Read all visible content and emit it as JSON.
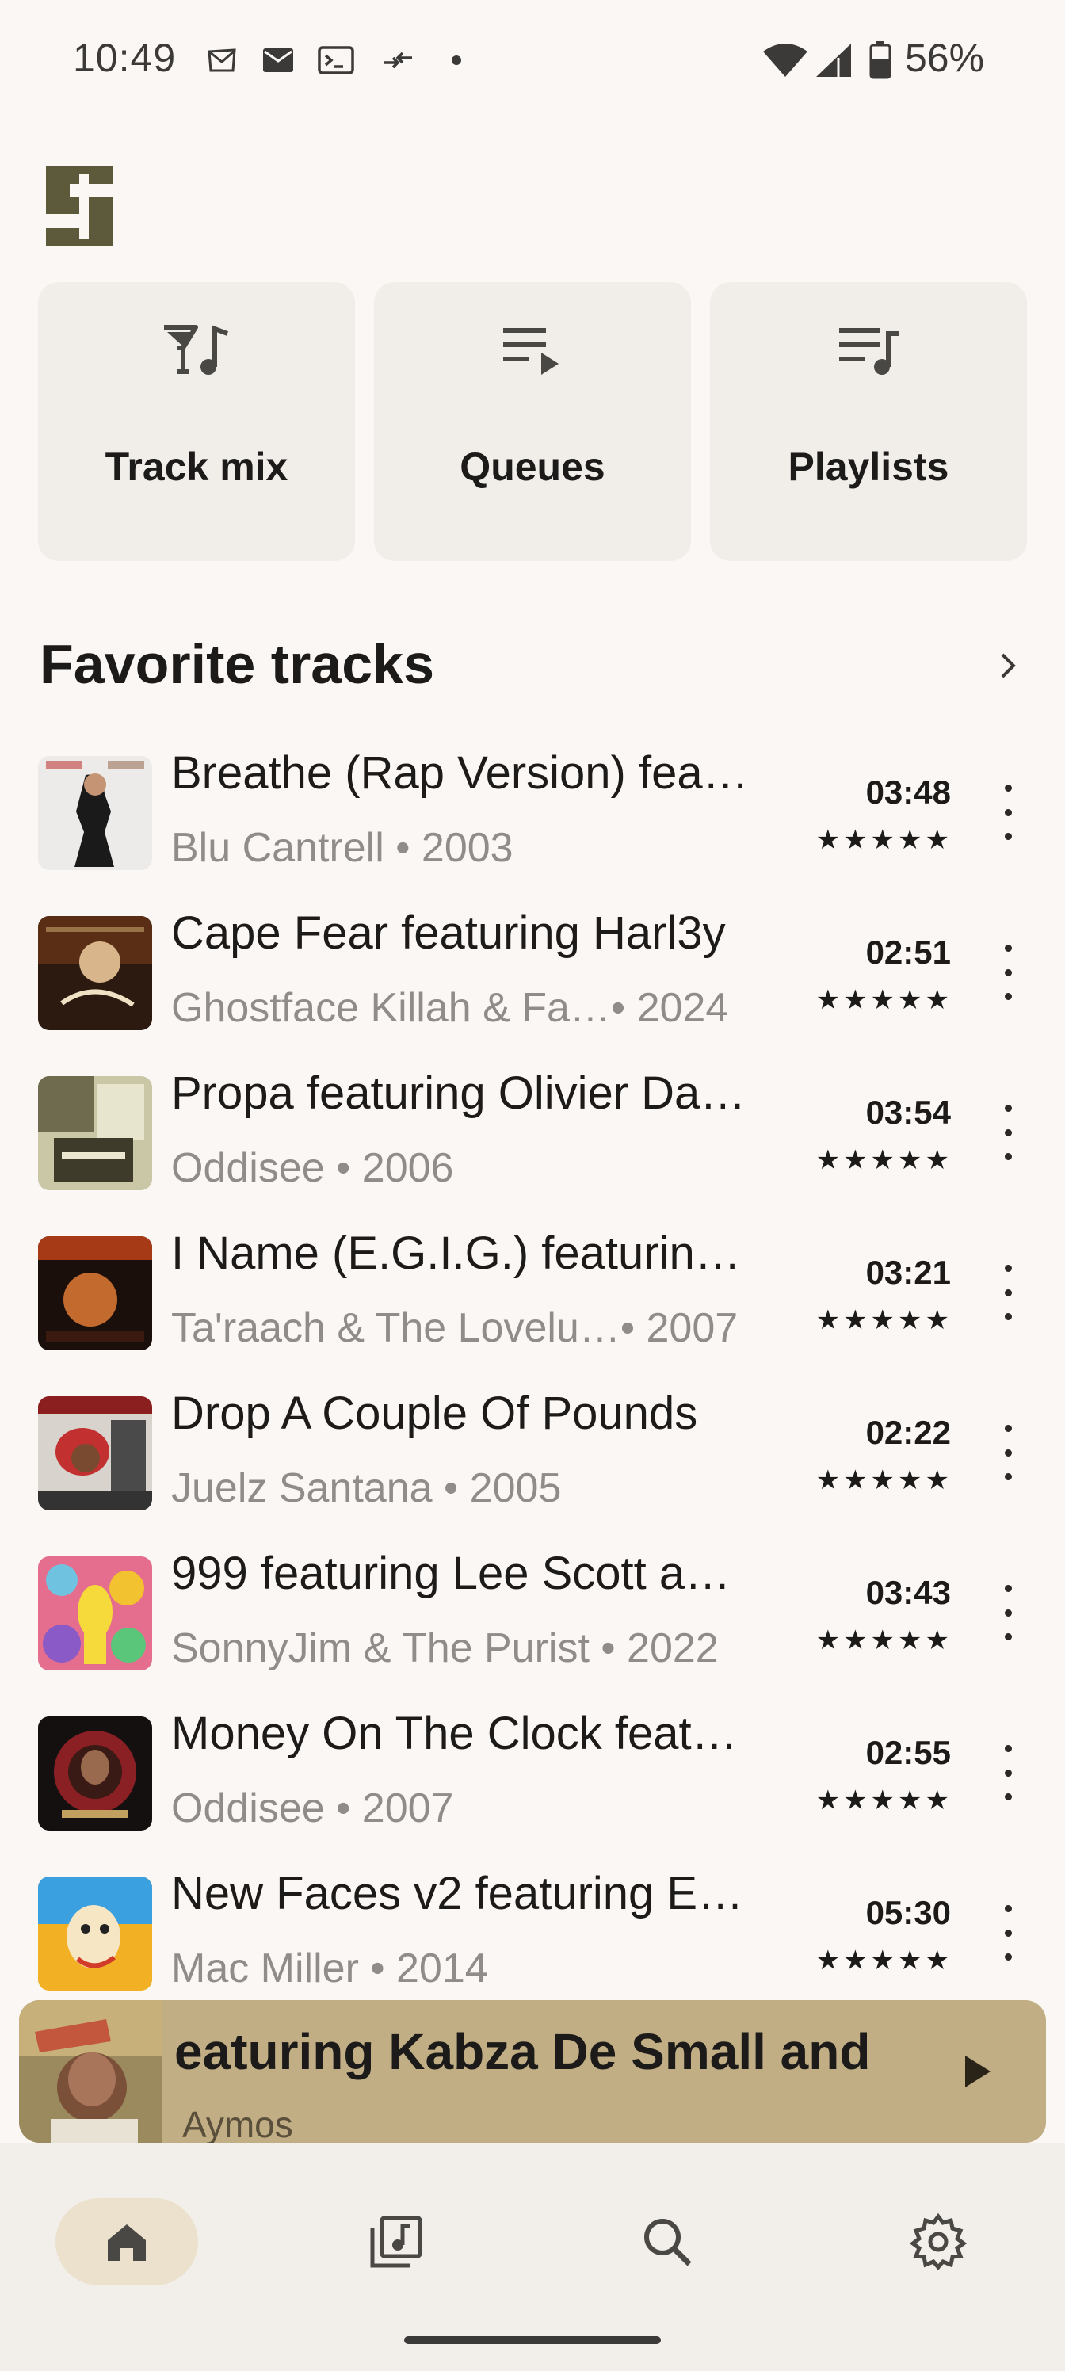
{
  "status_bar": {
    "time": "10:49",
    "battery": "56%",
    "left_icons": [
      "mail-outline-icon",
      "mail-filled-icon",
      "terminal-icon",
      "data-transfer-icon",
      "dot-icon"
    ],
    "right_icons": [
      "wifi-icon",
      "cellular-signal-icon",
      "battery-icon"
    ]
  },
  "app": {
    "logo_icon": "app-logo-icon"
  },
  "categories": [
    {
      "label": "Track mix",
      "icon": "track-mix-icon"
    },
    {
      "label": "Queues",
      "icon": "queue-icon"
    },
    {
      "label": "Playlists",
      "icon": "playlist-icon"
    }
  ],
  "favorites": {
    "title": "Favorite tracks",
    "more_icon": "chevron-right-icon",
    "tracks": [
      {
        "title": "Breathe (Rap Version) fea…",
        "artist": "Blu Cantrell",
        "year": "• 2003",
        "duration": "03:48",
        "stars": "★★★★★"
      },
      {
        "title": "Cape Fear featuring Harl3y",
        "artist": "Ghostface Killah & Fa…",
        "year": " • 2024",
        "duration": "02:51",
        "stars": "★★★★★"
      },
      {
        "title": "Propa featuring Olivier Da…",
        "artist": "Oddisee",
        "year": "• 2006",
        "duration": "03:54",
        "stars": "★★★★★"
      },
      {
        "title": "I Name (E.G.I.G.) featurin…",
        "artist": "Ta'raach & The Lovelu…",
        "year": " • 2007",
        "duration": "03:21",
        "stars": "★★★★★"
      },
      {
        "title": "Drop A Couple Of Pounds",
        "artist": "Juelz Santana",
        "year": "• 2005",
        "duration": "02:22",
        "stars": "★★★★★"
      },
      {
        "title": "999 featuring Lee Scott a…",
        "artist": "SonnyJim & The Purist",
        "year": "• 2022",
        "duration": "03:43",
        "stars": "★★★★★"
      },
      {
        "title": "Money On The Clock feat…",
        "artist": "Oddisee",
        "year": "• 2007",
        "duration": "02:55",
        "stars": "★★★★★"
      },
      {
        "title": "New Faces v2 featuring E…",
        "artist": "Mac Miller",
        "year": "• 2014",
        "duration": "05:30",
        "stars": "★★★★★"
      }
    ]
  },
  "mini_player": {
    "title": "eaturing Kabza De Small and",
    "artist": "Aymos",
    "play_icon": "play-icon"
  },
  "bottom_nav": [
    {
      "name": "home",
      "icon": "home-icon",
      "active": true
    },
    {
      "name": "library",
      "icon": "music-library-icon",
      "active": false
    },
    {
      "name": "search",
      "icon": "search-icon",
      "active": false
    },
    {
      "name": "settings",
      "icon": "gear-icon",
      "active": false
    }
  ],
  "colors": {
    "background": "#fbf7f4",
    "card": "#f1eeea",
    "mini_player": "#c2ae85",
    "nav_active": "#ebe1cc",
    "secondary_text": "#8f8c89"
  }
}
